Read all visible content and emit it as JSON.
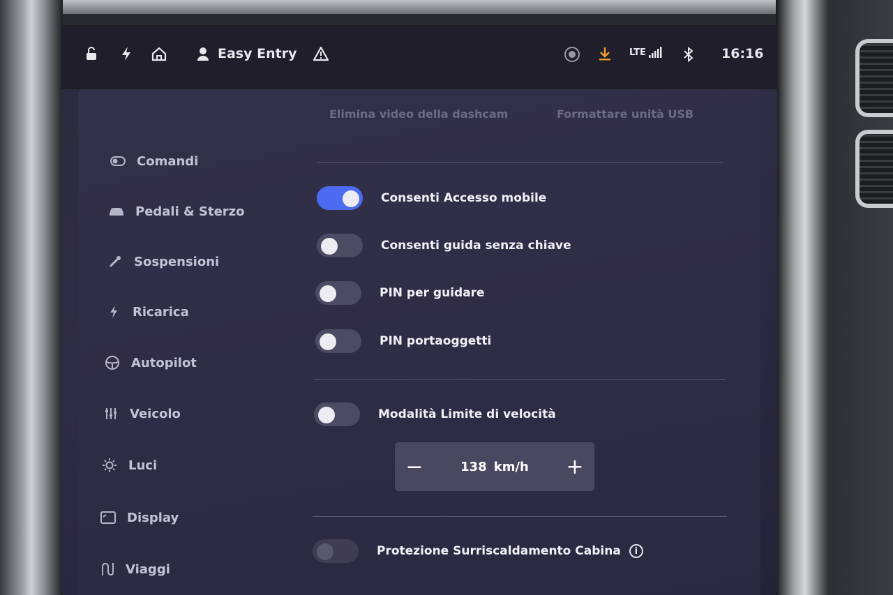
{
  "statusbar": {
    "profile_name": "Easy Entry",
    "network": "LTE",
    "time": "16:16",
    "icons": [
      "lock-open-icon",
      "bolt-icon",
      "home-icon",
      "user-icon",
      "warning-icon",
      "record-icon",
      "download-icon",
      "signal-icon",
      "bluetooth-icon"
    ],
    "download_color": "#f0a030"
  },
  "top_links": {
    "delete_dashcam": "Elimina video della dashcam",
    "format_usb": "Formattare unità USB"
  },
  "sidebar": {
    "items": [
      {
        "label": "Comandi",
        "icon": "toggle-icon"
      },
      {
        "label": "Pedali & Sterzo",
        "icon": "car-icon"
      },
      {
        "label": "Sospensioni",
        "icon": "wrench-icon"
      },
      {
        "label": "Ricarica",
        "icon": "bolt-icon"
      },
      {
        "label": "Autopilot",
        "icon": "steering-wheel-icon"
      },
      {
        "label": "Veicolo",
        "icon": "sliders-icon"
      },
      {
        "label": "Luci",
        "icon": "sun-icon"
      },
      {
        "label": "Display",
        "icon": "display-icon"
      },
      {
        "label": "Viaggi",
        "icon": "route-icon"
      }
    ]
  },
  "settings": {
    "mobile_access": {
      "label": "Consenti Accesso mobile",
      "on": true
    },
    "keyless_driving": {
      "label": "Consenti guida senza chiave",
      "on": false
    },
    "pin_to_drive": {
      "label": "PIN per guidare",
      "on": false
    },
    "glovebox_pin": {
      "label": "PIN portaoggetti",
      "on": false
    },
    "speed_limit_mode": {
      "label": "Modalità Limite di velocità",
      "on": false
    },
    "speed_limit": {
      "value": "138",
      "unit": "km/h",
      "minus": "−",
      "plus": "+"
    },
    "cabin_overheat": {
      "label": "Protezione Surriscaldamento Cabina",
      "on": false,
      "info": "i"
    }
  },
  "colors": {
    "accent": "#4b6cf0",
    "panel": "#2f2c46"
  }
}
